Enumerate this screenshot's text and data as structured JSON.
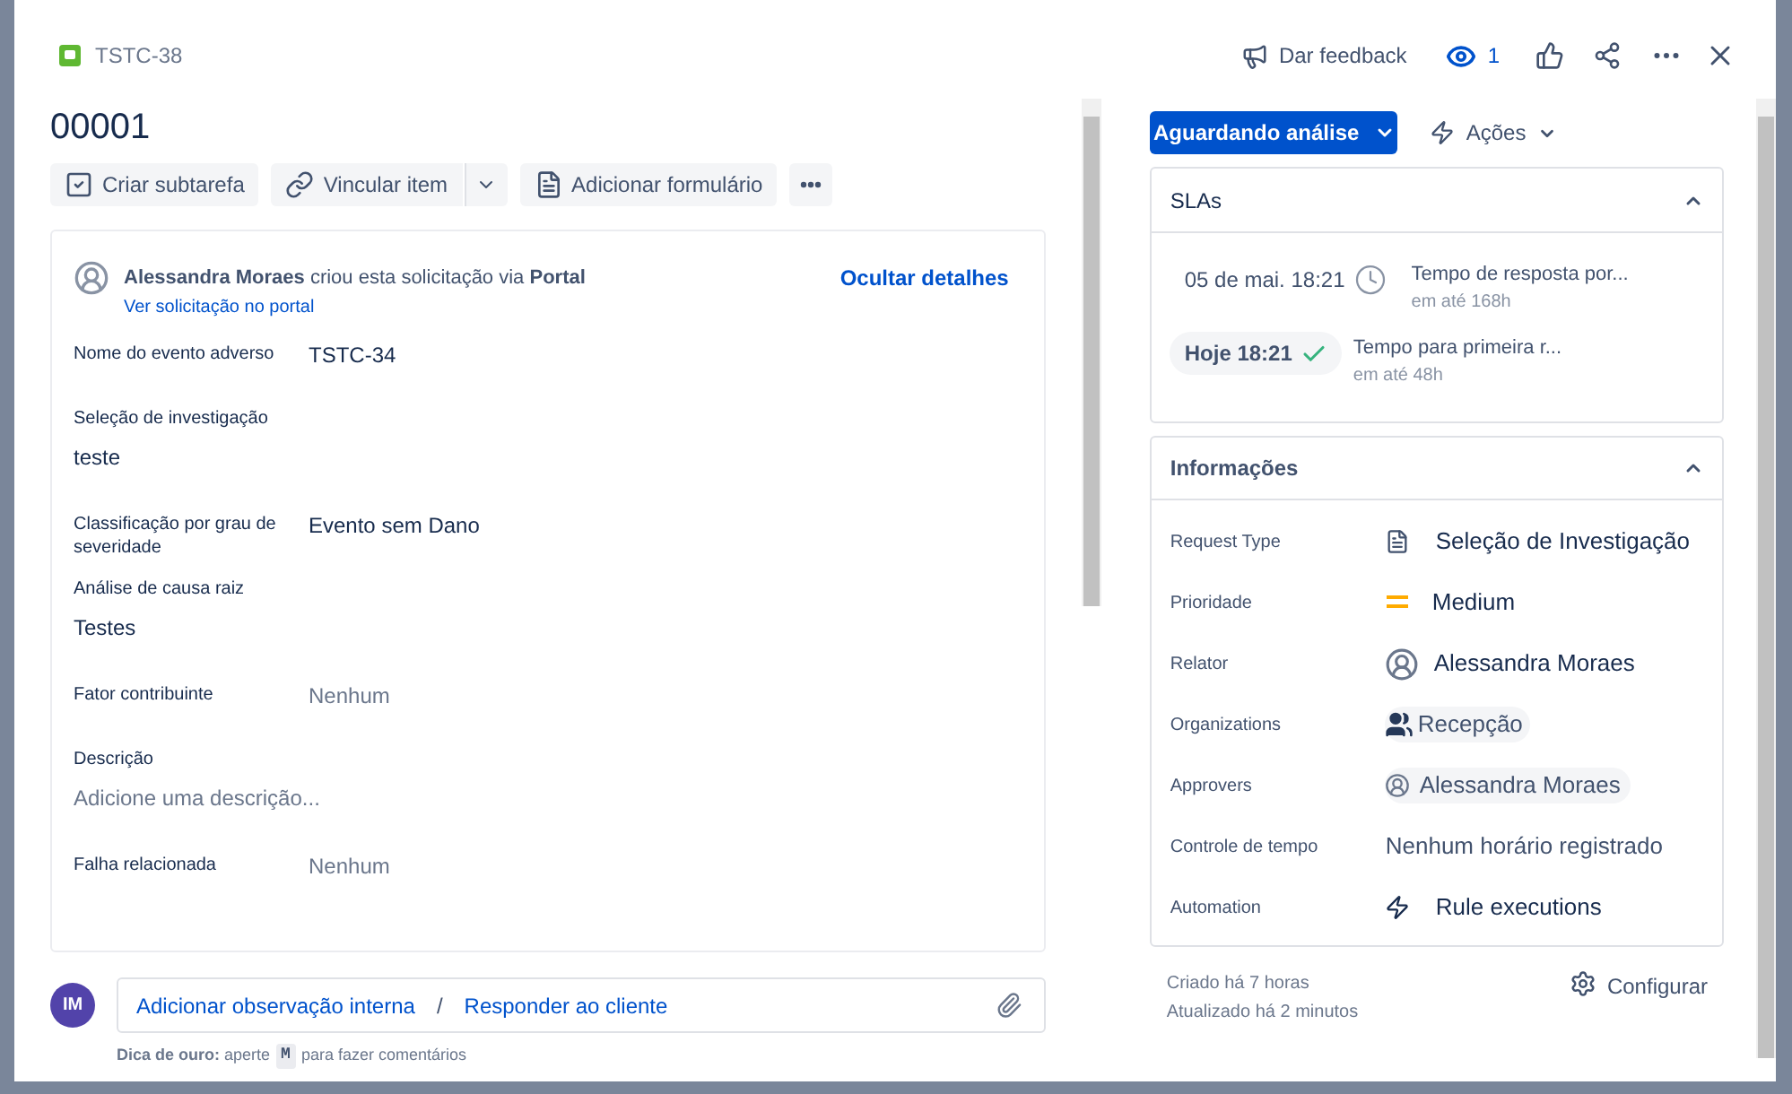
{
  "issue": {
    "key": "TSTC-38",
    "title": "00001"
  },
  "header_actions": {
    "feedback": "Dar feedback",
    "watchers": "1"
  },
  "toolbar": [
    {
      "label": "Criar subtarefa",
      "kind": "subtask"
    },
    {
      "label": "Vincular item",
      "kind": "link"
    },
    {
      "label": "Adicionar formulário",
      "kind": "form"
    }
  ],
  "request": {
    "sentence": "**Alessandra Moraes** criou esta solicitação via **Portal**",
    "portal_link": "Ver solicitação no portal",
    "toggle": "Ocultar detalhes"
  },
  "fields": [
    {
      "label": "Nome do evento adverso",
      "value": "TSTC-34",
      "kind": "inline",
      "muted": false
    },
    {
      "label": "Seleção de investigação",
      "value": "teste",
      "kind": "stacked",
      "muted": false
    },
    {
      "label": "Classificação por grau de severidade",
      "value": "Evento sem Dano",
      "kind": "inline",
      "muted": false
    },
    {
      "label": "Análise de causa raiz",
      "value": "Testes",
      "kind": "stacked",
      "muted": false
    },
    {
      "label": "Fator contribuinte",
      "value": "Nenhum",
      "kind": "inline",
      "muted": true
    },
    {
      "label": "Descrição",
      "value": "Adicione uma descrição...",
      "kind": "stacked",
      "muted": true
    },
    {
      "label": "Falha relacionada",
      "value": "Nenhum",
      "kind": "inline",
      "muted": true
    }
  ],
  "comment": {
    "avatar": "IM",
    "internal": "Adicionar observação interna",
    "separator": "/",
    "reply": "Responder ao cliente"
  },
  "tip": {
    "lead": "**Dica de ouro:** aperte",
    "key": "M",
    "trail": "para fazer comentários"
  },
  "status": {
    "label": "Aguardando análise",
    "actions": "Ações"
  },
  "slas": {
    "title": "SLAs",
    "expanded": true,
    "items": [
      {
        "time": "05 de mai. 18:21",
        "name": "Tempo de resposta por...",
        "goal": "em até 168h",
        "kind": "running"
      },
      {
        "time": "Hoje 18:21",
        "name": "Tempo para primeira r...",
        "goal": "em até 48h",
        "kind": "met"
      }
    ]
  },
  "details": {
    "title": "Informações",
    "expanded": true,
    "rows": [
      {
        "label": "Request Type",
        "value": "Seleção de Investigação",
        "kind": "request-type"
      },
      {
        "label": "Prioridade",
        "value": "Medium",
        "kind": "priority"
      },
      {
        "label": "Relator",
        "value": "Alessandra Moraes",
        "kind": "user"
      },
      {
        "label": "Organizations",
        "value": "Recepção",
        "kind": "organization"
      },
      {
        "label": "Approvers",
        "value": "Alessandra Moraes",
        "kind": "approver"
      },
      {
        "label": "Controle de tempo",
        "value": "Nenhum horário registrado",
        "kind": "text"
      },
      {
        "label": "Automation",
        "value": "Rule executions",
        "kind": "automation"
      }
    ]
  },
  "footer": {
    "created": "Criado há 7 horas",
    "updated": "Atualizado há 2 minutos",
    "configure": "Configurar"
  }
}
